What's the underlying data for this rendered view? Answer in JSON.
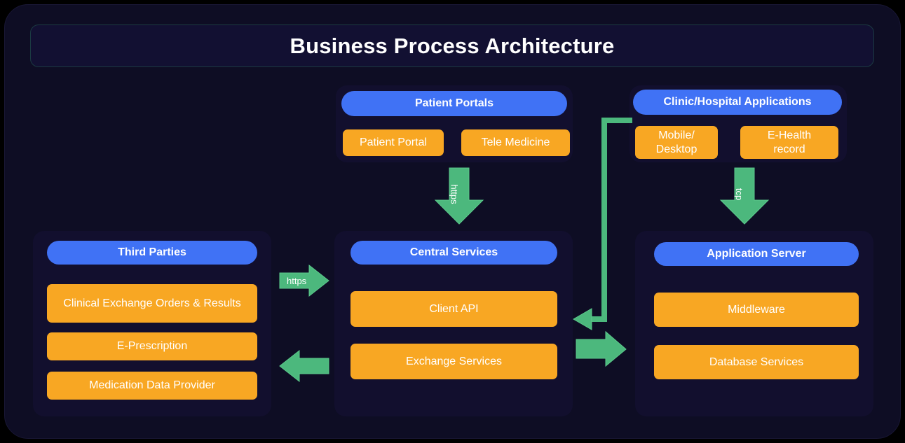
{
  "title": "Business Process Architecture",
  "theme": {
    "page_background": "#000000",
    "frame_background": "#0e0d24",
    "panel_background": "#120f2e",
    "header_blue": "#4072f5",
    "node_orange": "#f8a723",
    "arrow_green": "#4cb87d",
    "text_white": "#ffffff",
    "title_bar_background": "#121032",
    "title_bar_border": "#1b3a42"
  },
  "groups": {
    "patient_portals": {
      "header": "Patient Portals",
      "nodes": [
        {
          "label": "Patient Portal"
        },
        {
          "label": "Tele Medicine"
        }
      ]
    },
    "clinic_hospital": {
      "header": "Clinic/Hospital Applications",
      "nodes": [
        {
          "line1": "Mobile/",
          "line2": "Desktop"
        },
        {
          "line1": "E-Health",
          "line2": "record"
        }
      ]
    },
    "third_parties": {
      "header": "Third Parties",
      "nodes": [
        {
          "label": "Clinical Exchange Orders & Results"
        },
        {
          "label": "E-Prescription"
        },
        {
          "label": "Medication Data Provider"
        }
      ]
    },
    "central_services": {
      "header": "Central Services",
      "nodes": [
        {
          "label": "Client API"
        },
        {
          "label": "Exchange Services"
        }
      ]
    },
    "application_server": {
      "header": "Application Server",
      "nodes": [
        {
          "label": "Middleware"
        },
        {
          "label": "Database Services"
        }
      ]
    }
  },
  "connectors": {
    "portals_to_central": {
      "label": "https",
      "direction": "down"
    },
    "clinic_to_appserver": {
      "label": "tcp",
      "direction": "down"
    },
    "thirdparty_to_central": {
      "label": "https",
      "direction": "right"
    },
    "central_to_thirdparty": {
      "label": "",
      "direction": "left"
    },
    "appserver_to_central": {
      "label": "",
      "direction": "left"
    },
    "central_to_appserver": {
      "label": "",
      "direction": "right"
    },
    "clinic_to_central_feedback": {
      "label": "",
      "direction": "left"
    }
  }
}
